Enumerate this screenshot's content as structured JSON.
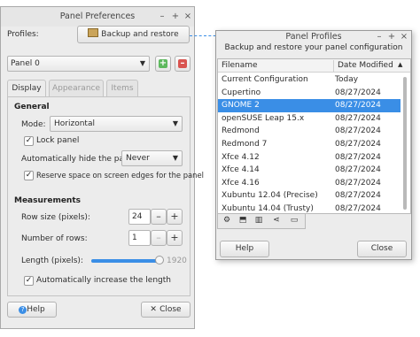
{
  "prefs": {
    "title": "Panel Preferences",
    "profiles_label": "Profiles:",
    "backup_button": "Backup and restore",
    "panel_select": "Panel 0",
    "tabs": [
      "Display",
      "Appearance",
      "Items"
    ],
    "general": {
      "heading": "General",
      "mode_label": "Mode:",
      "mode_value": "Horizontal",
      "lock_panel": "Lock panel",
      "autohide_label": "Automatically hide the panel:",
      "autohide_value": "Never",
      "reserve_space": "Reserve space on screen edges for the panel"
    },
    "measurements": {
      "heading": "Measurements",
      "row_size_label": "Row size (pixels):",
      "row_size_value": "24",
      "rows_label": "Number of rows:",
      "rows_value": "1",
      "length_label": "Length (pixels):",
      "length_value": "1920",
      "length_fraction": 1.0,
      "auto_increase": "Automatically increase the length"
    },
    "help_button": "Help",
    "close_button": "Close"
  },
  "profiles": {
    "title": "Panel Profiles",
    "subtitle": "Backup and restore your panel configuration",
    "columns": [
      "Filename",
      "Date Modified"
    ],
    "rows": [
      [
        "Current Configuration",
        "Today"
      ],
      [
        "Cupertino",
        "08/27/2024"
      ],
      [
        "GNOME 2",
        "08/27/2024"
      ],
      [
        "openSUSE Leap 15.x",
        "08/27/2024"
      ],
      [
        "Redmond",
        "08/27/2024"
      ],
      [
        "Redmond 7",
        "08/27/2024"
      ],
      [
        "Xfce 4.12",
        "08/27/2024"
      ],
      [
        "Xfce 4.14",
        "08/27/2024"
      ],
      [
        "Xfce 4.16",
        "08/27/2024"
      ],
      [
        "Xubuntu 12.04 (Precise)",
        "08/27/2024"
      ],
      [
        "Xubuntu 14.04 (Trusty)",
        "08/27/2024"
      ]
    ],
    "selected_row": "GNOME 2",
    "help_button": "Help",
    "close_button": "Close"
  },
  "colors": {
    "selection": "#3a8ee6",
    "add": "#5cb85c",
    "remove": "#d9534f"
  }
}
